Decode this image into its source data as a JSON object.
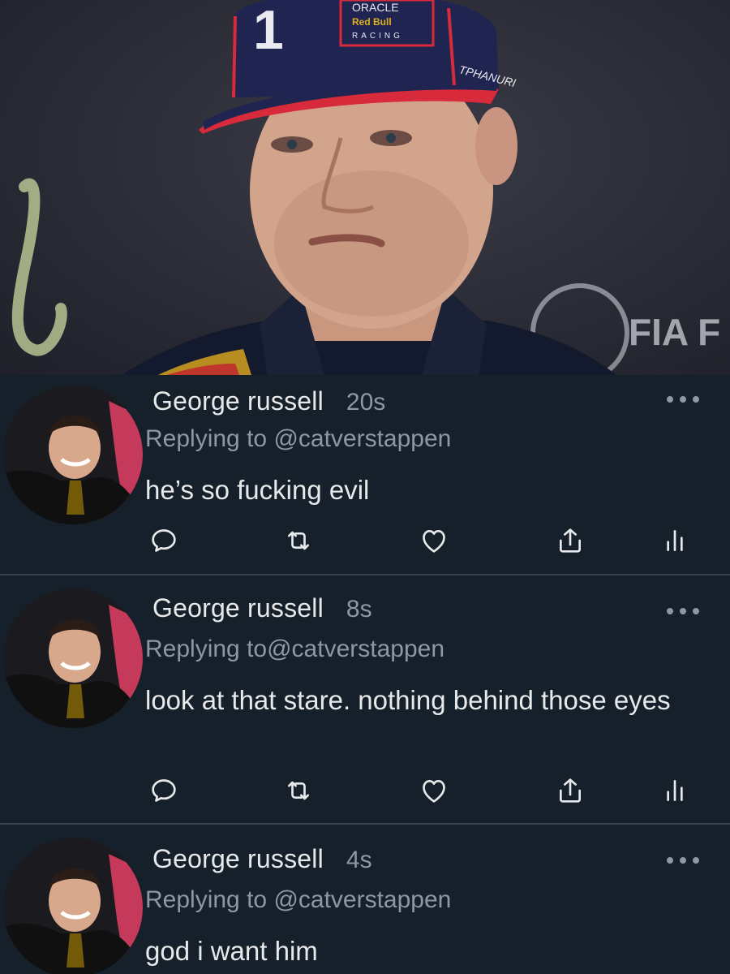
{
  "photo": {
    "cap_number": "1",
    "cap_brand_top": "ORACLE",
    "cap_brand_mid": "Red Bull",
    "cap_brand_bottom": "RACING",
    "cap_side_text": "TPHANURI",
    "background_logo": "FIA F",
    "background_script": "h"
  },
  "tweets": [
    {
      "author": "George russell",
      "time": "20s",
      "replying_prefix": "Replying to",
      "replying_handle": "@catverstappen",
      "text": "he’s so fucking evil"
    },
    {
      "author": "George russell",
      "time": "8s",
      "replying_prefix": "Replying to",
      "replying_handle": "@catverstappen",
      "text": "look at that stare. nothing behind those eyes"
    },
    {
      "author": "George russell",
      "time": "4s",
      "replying_prefix": "Replying to",
      "replying_handle": "@catverstappen",
      "text": "god i want him"
    }
  ],
  "icons": {
    "reply": "reply-icon",
    "retweet": "retweet-icon",
    "like": "heart-icon",
    "share": "share-icon",
    "analytics": "analytics-icon",
    "more": "more-icon"
  },
  "colors": {
    "background": "#15202b",
    "text": "#e7e9ea",
    "secondary": "#8b98a5",
    "divider": "#38444d"
  }
}
